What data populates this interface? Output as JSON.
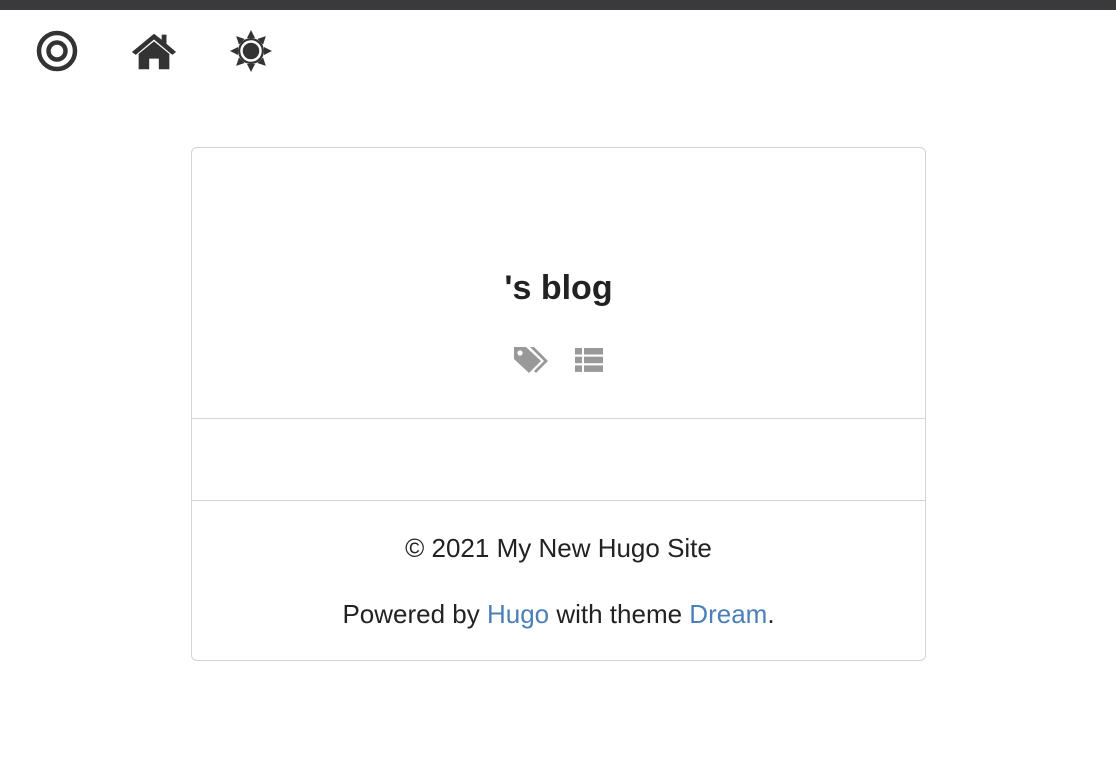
{
  "nav": {
    "icons": [
      "target-icon",
      "home-icon",
      "sun-icon"
    ]
  },
  "card": {
    "title": "'s blog",
    "icons": [
      "tags-icon",
      "list-icon"
    ],
    "footer": {
      "copyright": "© 2021 My New Hugo Site",
      "powered_prefix": "Powered by ",
      "hugo_link": "Hugo",
      "middle_text": " with theme ",
      "theme_link": "Dream",
      "suffix": "."
    }
  },
  "colors": {
    "topbar": "#3a3a3c",
    "nav_icon": "#333333",
    "card_icon": "#999999",
    "link": "#4a7fb8",
    "border": "#d4d4d4"
  }
}
